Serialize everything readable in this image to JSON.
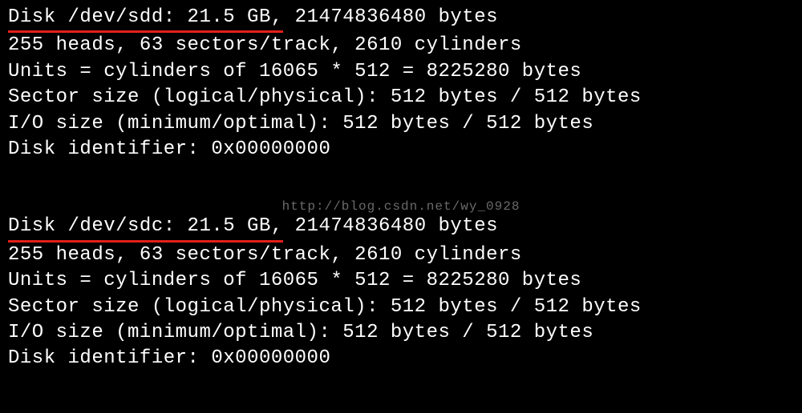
{
  "disk1": {
    "header_hl": "Disk /dev/sdd: 21.5 GB,",
    "header_rest": " 21474836480 bytes",
    "geometry": "255 heads, 63 sectors/track, 2610 cylinders",
    "units": "Units = cylinders of 16065 * 512 = 8225280 bytes",
    "sector": "Sector size (logical/physical): 512 bytes / 512 bytes",
    "io": "I/O size (minimum/optimal): 512 bytes / 512 bytes",
    "ident": "Disk identifier: 0x00000000"
  },
  "disk2": {
    "header_hl": "Disk /dev/sdc: 21.5 GB,",
    "header_rest": " 21474836480 bytes",
    "geometry": "255 heads, 63 sectors/track, 2610 cylinders",
    "units": "Units = cylinders of 16065 * 512 = 8225280 bytes",
    "sector": "Sector size (logical/physical): 512 bytes / 512 bytes",
    "io": "I/O size (minimum/optimal): 512 bytes / 512 bytes",
    "ident": "Disk identifier: 0x00000000"
  },
  "watermark": "http://blog.csdn.net/wy_0928"
}
